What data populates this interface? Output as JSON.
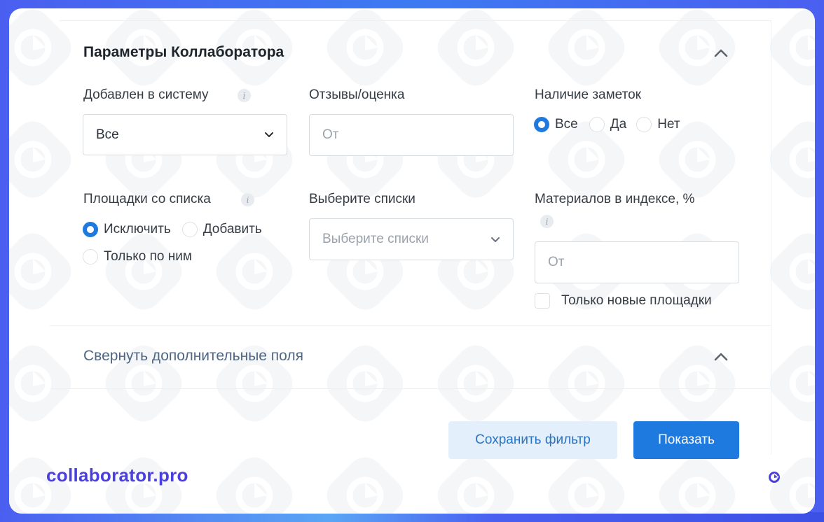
{
  "filter": {
    "section_title": "Параметры Коллаборатора",
    "added_to_system": {
      "label": "Добавлен в систему",
      "value": "Все"
    },
    "reviews": {
      "label": "Отзывы/оценка",
      "placeholder": "От"
    },
    "notes": {
      "label": "Наличие заметок",
      "options": [
        "Все",
        "Да",
        "Нет"
      ],
      "selected": "Все"
    },
    "sites_from_list": {
      "label": "Площадки со списка",
      "options": [
        "Исключить",
        "Добавить",
        "Только по ним"
      ],
      "selected": "Исключить"
    },
    "choose_lists": {
      "label": "Выберите списки",
      "placeholder": "Выберите списки"
    },
    "index_materials": {
      "label": "Материалов в индексе, %",
      "placeholder": "От"
    },
    "only_new_sites": {
      "label": "Только новые площадки",
      "checked": false
    },
    "collapse_label": "Свернуть дополнительные поля",
    "save_filter_label": "Сохранить фильтр",
    "show_label": "Показать"
  },
  "info_icon_glyph": "i",
  "brand": {
    "name": "collaborator.pro"
  },
  "colors": {
    "primary": "#1f7ae0",
    "brand": "#4b3fe0",
    "background": "#3d7af2"
  }
}
